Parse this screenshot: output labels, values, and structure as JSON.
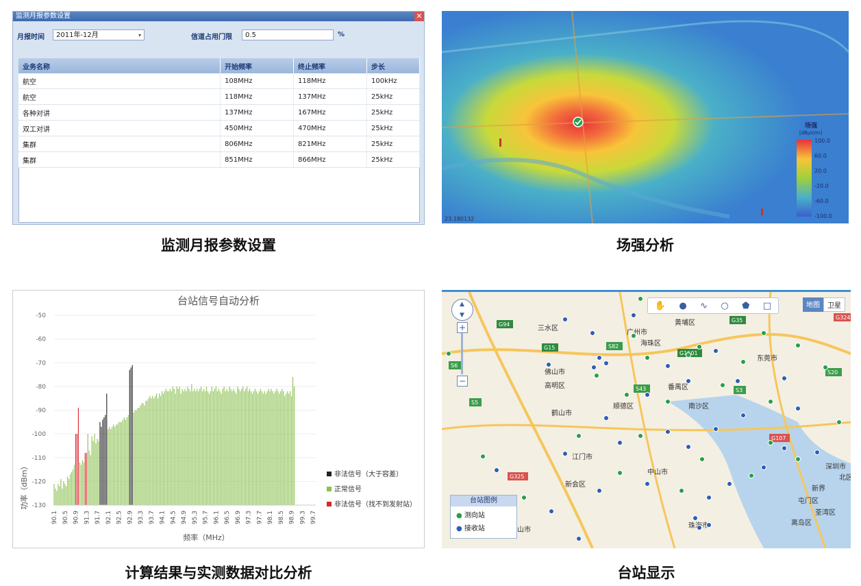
{
  "captions": {
    "p1": "监测月报参数设置",
    "p2": "场强分析",
    "p3": "计算结果与实测数据对比分析",
    "p4": "台站显示"
  },
  "dialog": {
    "title": "监测月报参数设置",
    "close": "✕",
    "month_label": "月报时间",
    "month_value": "2011年-12月",
    "threshold_label": "信道占用门限",
    "threshold_value": "0.5",
    "percent": "%",
    "columns": [
      "业务名称",
      "开始频率",
      "终止频率",
      "步长"
    ],
    "rows": [
      [
        "航空",
        "108MHz",
        "118MHz",
        "100kHz"
      ],
      [
        "航空",
        "118MHz",
        "137MHz",
        "25kHz"
      ],
      [
        "各种对讲",
        "137MHz",
        "167MHz",
        "25kHz"
      ],
      [
        "双工对讲",
        "450MHz",
        "470MHz",
        "25kHz"
      ],
      [
        "集群",
        "806MHz",
        "821MHz",
        "25kHz"
      ],
      [
        "集群",
        "851MHz",
        "866MHz",
        "25kHz"
      ]
    ]
  },
  "heatmap": {
    "legend_title": "场强",
    "legend_unit": "[dBµV/m]",
    "legend_ticks": [
      "100.0",
      "60.0",
      "20.0",
      "-20.0",
      "-60.0",
      "-100.0"
    ],
    "coordinate": "23.180132"
  },
  "map": {
    "type_map": "地图",
    "type_sat": "卫星",
    "legend_title": "台站图例",
    "legend_items": [
      "测向站",
      "接收站"
    ],
    "labels": [
      "广州市",
      "海珠区",
      "番禺区",
      "东莞市",
      "佛山市",
      "南沙区",
      "江门市",
      "中山市",
      "新会区",
      "深圳市",
      "新界",
      "屯门区",
      "高明区",
      "鹤山市",
      "顺德区",
      "珠海市",
      "离岛区",
      "三水区",
      "黄埔区",
      "荃湾区",
      "北区",
      "台山市"
    ],
    "road_labels": [
      "G94",
      "G15",
      "S82",
      "G1501",
      "S5",
      "S43",
      "G35",
      "S20",
      "G324",
      "S3",
      "G107",
      "G325",
      "S6"
    ],
    "zoom_plus": "+",
    "zoom_minus": "−"
  },
  "chart_data": {
    "type": "bar",
    "title": "台站信号自动分析",
    "xlabel": "频率（MHz）",
    "ylabel": "功率（dBm）",
    "ylim": [
      -130,
      -50
    ],
    "yticks": [
      -50,
      -60,
      -70,
      -80,
      -90,
      -100,
      -110,
      -120,
      -130
    ],
    "xtick_labels": [
      "90.1",
      "90.5",
      "90.9",
      "91.3",
      "91.7",
      "92.1",
      "92.5",
      "92.9",
      "93.3",
      "93.7",
      "94.1",
      "94.5",
      "94.9",
      "95.3",
      "95.7",
      "96.1",
      "96.5",
      "96.9",
      "97.3",
      "97.7",
      "98.1",
      "98.5",
      "98.9",
      "99.3",
      "99.7"
    ],
    "legend": [
      "非法信号（大于容差）",
      "正常信号",
      "非法信号（找不到发射站）"
    ],
    "series_colors": {
      "black": "#222222",
      "green": "#8cc152",
      "red": "#d9262c"
    },
    "x": [
      90.1,
      90.15,
      90.2,
      90.25,
      90.3,
      90.35,
      90.4,
      90.45,
      90.5,
      90.55,
      90.6,
      90.65,
      90.7,
      90.75,
      90.8,
      90.85,
      90.9,
      90.95,
      91.0,
      91.05,
      91.1,
      91.15,
      91.2,
      91.25,
      91.3,
      91.35,
      91.4,
      91.45,
      91.5,
      91.55,
      91.6,
      91.65,
      91.7,
      91.75,
      91.8,
      91.85,
      91.9,
      91.95,
      92.0,
      92.05,
      92.1,
      92.15,
      92.2,
      92.25,
      92.3,
      92.35,
      92.4,
      92.45,
      92.5,
      92.55,
      92.6,
      92.65,
      92.7,
      92.75,
      92.8,
      92.85,
      92.9,
      92.95,
      93.0,
      93.05,
      93.1,
      93.15,
      93.2,
      93.25,
      93.3,
      93.35,
      93.4,
      93.45,
      93.5,
      93.55,
      93.6,
      93.65,
      93.7,
      93.75,
      93.8,
      93.85,
      93.9,
      93.95,
      94.0,
      94.05,
      94.1,
      94.15,
      94.2,
      94.25,
      94.3,
      94.35,
      94.4,
      94.45,
      94.5,
      94.55,
      94.6,
      94.65,
      94.7,
      94.75,
      94.8,
      94.85,
      94.9,
      94.95,
      95.0,
      95.05,
      95.1,
      95.15,
      95.2,
      95.25,
      95.3,
      95.35,
      95.4,
      95.45,
      95.5,
      95.55,
      95.6,
      95.65,
      95.7,
      95.75,
      95.8,
      95.85,
      95.9,
      95.95,
      96.0,
      96.05,
      96.1,
      96.15,
      96.2,
      96.25,
      96.3,
      96.35,
      96.4,
      96.45,
      96.5,
      96.55,
      96.6,
      96.65,
      96.7,
      96.75,
      96.8,
      96.85,
      96.9,
      96.95,
      97.0,
      97.05,
      97.1,
      97.15,
      97.2,
      97.25,
      97.3,
      97.35,
      97.4,
      97.45,
      97.5,
      97.55,
      97.6,
      97.65,
      97.7,
      97.75,
      97.8,
      97.85,
      97.9,
      97.95,
      98.0,
      98.05,
      98.1,
      98.15,
      98.2,
      98.25,
      98.3,
      98.35,
      98.4,
      98.45,
      98.5,
      98.55,
      98.6,
      98.65,
      98.7,
      98.75,
      98.8,
      98.85,
      98.9,
      98.95,
      99.0,
      99.05,
      99.1,
      99.15,
      99.2,
      99.25,
      99.3,
      99.35,
      99.4,
      99.45,
      99.5,
      99.55,
      99.6,
      99.65,
      99.7,
      99.75,
      99.8
    ],
    "values": [
      -121,
      -123,
      -124,
      -121,
      -122,
      -119,
      -123,
      -120,
      -121,
      -122,
      -118,
      -119,
      -117,
      -116,
      -115,
      -113,
      -100,
      -100,
      -89,
      -112,
      -113,
      -111,
      -112,
      -108,
      -108,
      -100,
      -107,
      -109,
      -101,
      -103,
      -100,
      -104,
      -102,
      -103,
      -95,
      -97,
      -94,
      -93,
      -92,
      -83,
      -98,
      -97,
      -98,
      -97,
      -96,
      -97,
      -96,
      -96,
      -95,
      -95,
      -95,
      -94,
      -93,
      -94,
      -93,
      -92,
      -73,
      -72,
      -71,
      -91,
      -90,
      -90,
      -89,
      -89,
      -88,
      -87,
      -87,
      -88,
      -86,
      -86,
      -85,
      -84,
      -85,
      -84,
      -85,
      -84,
      -83,
      -85,
      -83,
      -84,
      -82,
      -83,
      -82,
      -81,
      -82,
      -82,
      -81,
      -82,
      -80,
      -81,
      -83,
      -80,
      -81,
      -80,
      -83,
      -81,
      -82,
      -81,
      -82,
      -80,
      -81,
      -82,
      -79,
      -82,
      -81,
      -82,
      -81,
      -82,
      -81,
      -80,
      -82,
      -81,
      -82,
      -80,
      -82,
      -83,
      -82,
      -80,
      -82,
      -81,
      -80,
      -82,
      -81,
      -82,
      -83,
      -81,
      -80,
      -82,
      -81,
      -82,
      -80,
      -81,
      -82,
      -81,
      -82,
      -83,
      -80,
      -81,
      -82,
      -81,
      -80,
      -82,
      -81,
      -80,
      -82,
      -81,
      -82,
      -83,
      -82,
      -81,
      -82,
      -83,
      -82,
      -81,
      -82,
      -83,
      -82,
      -83,
      -82,
      -81,
      -82,
      -81,
      -82,
      -83,
      -82,
      -81,
      -82,
      -83,
      -82,
      -81,
      -82,
      -84,
      -83,
      -82,
      -83,
      -82,
      -84,
      -76,
      -80
    ],
    "colors": [
      "green",
      "green",
      "green",
      "green",
      "green",
      "green",
      "green",
      "green",
      "green",
      "green",
      "green",
      "green",
      "green",
      "green",
      "green",
      "green",
      "red",
      "red",
      "red",
      "green",
      "green",
      "green",
      "green",
      "red",
      "red",
      "green",
      "green",
      "green",
      "green",
      "green",
      "green",
      "green",
      "green",
      "green",
      "black",
      "black",
      "black",
      "black",
      "black",
      "black",
      "green",
      "green",
      "green",
      "green",
      "green",
      "green",
      "green",
      "green",
      "green",
      "green",
      "green",
      "green",
      "green",
      "green",
      "green",
      "green",
      "black",
      "black",
      "black",
      "green",
      "green",
      "green",
      "green",
      "green",
      "green",
      "green",
      "green",
      "green",
      "green",
      "green",
      "green",
      "green",
      "green",
      "green",
      "green",
      "green",
      "green",
      "green",
      "green",
      "green",
      "green",
      "green",
      "green",
      "green",
      "green",
      "green",
      "green",
      "green",
      "green",
      "green",
      "green",
      "green",
      "green",
      "green",
      "green",
      "green",
      "green",
      "green",
      "green",
      "green",
      "green",
      "green",
      "green",
      "green",
      "green",
      "green",
      "green",
      "green",
      "green",
      "green",
      "green",
      "green",
      "green",
      "green",
      "green",
      "green",
      "green",
      "green",
      "green",
      "green",
      "green",
      "green",
      "green",
      "green",
      "green",
      "green",
      "green",
      "green",
      "green",
      "green",
      "green",
      "green",
      "green",
      "green",
      "green",
      "green",
      "green",
      "green",
      "green",
      "green",
      "green",
      "green",
      "green",
      "green",
      "green",
      "green",
      "green",
      "green",
      "green",
      "green",
      "green",
      "green",
      "green",
      "green",
      "green",
      "green",
      "green",
      "green",
      "green",
      "green",
      "green",
      "green",
      "green",
      "green",
      "green",
      "green",
      "green",
      "green",
      "green",
      "green",
      "green",
      "green",
      "green",
      "green",
      "green",
      "green",
      "green"
    ]
  }
}
